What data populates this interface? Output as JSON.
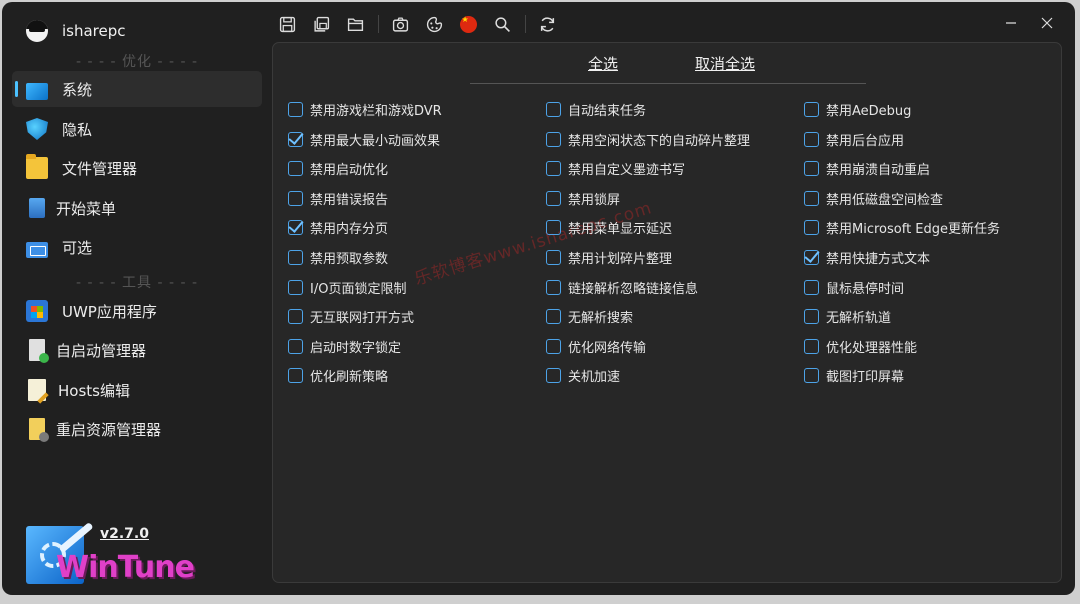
{
  "app": {
    "name": "isharepc"
  },
  "sidebar": {
    "section_optimize": "- - - - 优化 - - - -",
    "section_tools": "- - - - 工具 - - - -",
    "items": [
      {
        "label": "系统",
        "icon": "system-icon",
        "active": true
      },
      {
        "label": "隐私",
        "icon": "privacy-shield-icon",
        "active": false
      },
      {
        "label": "文件管理器",
        "icon": "folder-icon",
        "active": false
      },
      {
        "label": "开始菜单",
        "icon": "start-menu-icon",
        "active": false
      },
      {
        "label": "可选",
        "icon": "optional-features-icon",
        "active": false
      }
    ],
    "tools": [
      {
        "label": "UWP应用程序",
        "icon": "store-icon"
      },
      {
        "label": "自启动管理器",
        "icon": "autostart-icon"
      },
      {
        "label": "Hosts编辑",
        "icon": "hosts-edit-icon"
      },
      {
        "label": "重启资源管理器",
        "icon": "restart-explorer-icon"
      }
    ]
  },
  "branding": {
    "version": "v2.7.0",
    "logo_text": "WinTune"
  },
  "toolbar": {
    "icons": [
      "save-icon",
      "save-all-icon",
      "open-folder-icon",
      "camera-icon",
      "theme-icon",
      "language-flag-icon",
      "search-icon",
      "refresh-icon"
    ]
  },
  "main": {
    "select_all": "全选",
    "deselect_all": "取消全选",
    "watermark": "乐软博客www.isharepc.com",
    "columns": [
      [
        {
          "label": "禁用游戏栏和游戏DVR",
          "checked": false
        },
        {
          "label": "禁用最大最小动画效果",
          "checked": true
        },
        {
          "label": "禁用启动优化",
          "checked": false
        },
        {
          "label": "禁用错误报告",
          "checked": false
        },
        {
          "label": "禁用内存分页",
          "checked": true
        },
        {
          "label": "禁用预取参数",
          "checked": false
        },
        {
          "label": "I/O页面锁定限制",
          "checked": false
        },
        {
          "label": "无互联网打开方式",
          "checked": false
        },
        {
          "label": "启动时数字锁定",
          "checked": false
        },
        {
          "label": "优化刷新策略",
          "checked": false
        }
      ],
      [
        {
          "label": "自动结束任务",
          "checked": false
        },
        {
          "label": "禁用空闲状态下的自动碎片整理",
          "checked": false
        },
        {
          "label": "禁用自定义墨迹书写",
          "checked": false
        },
        {
          "label": "禁用锁屏",
          "checked": false
        },
        {
          "label": "禁用菜单显示延迟",
          "checked": false
        },
        {
          "label": "禁用计划碎片整理",
          "checked": false
        },
        {
          "label": "链接解析忽略链接信息",
          "checked": false
        },
        {
          "label": "无解析搜索",
          "checked": false
        },
        {
          "label": "优化网络传输",
          "checked": false
        },
        {
          "label": "关机加速",
          "checked": false
        }
      ],
      [
        {
          "label": "禁用AeDebug",
          "checked": false
        },
        {
          "label": "禁用后台应用",
          "checked": false
        },
        {
          "label": "禁用崩溃自动重启",
          "checked": false
        },
        {
          "label": "禁用低磁盘空间检查",
          "checked": false
        },
        {
          "label": "禁用Microsoft Edge更新任务",
          "checked": false
        },
        {
          "label": "禁用快捷方式文本",
          "checked": true
        },
        {
          "label": "鼠标悬停时间",
          "checked": false
        },
        {
          "label": "无解析轨道",
          "checked": false
        },
        {
          "label": "优化处理器性能",
          "checked": false
        },
        {
          "label": "截图打印屏幕",
          "checked": false
        }
      ]
    ]
  }
}
